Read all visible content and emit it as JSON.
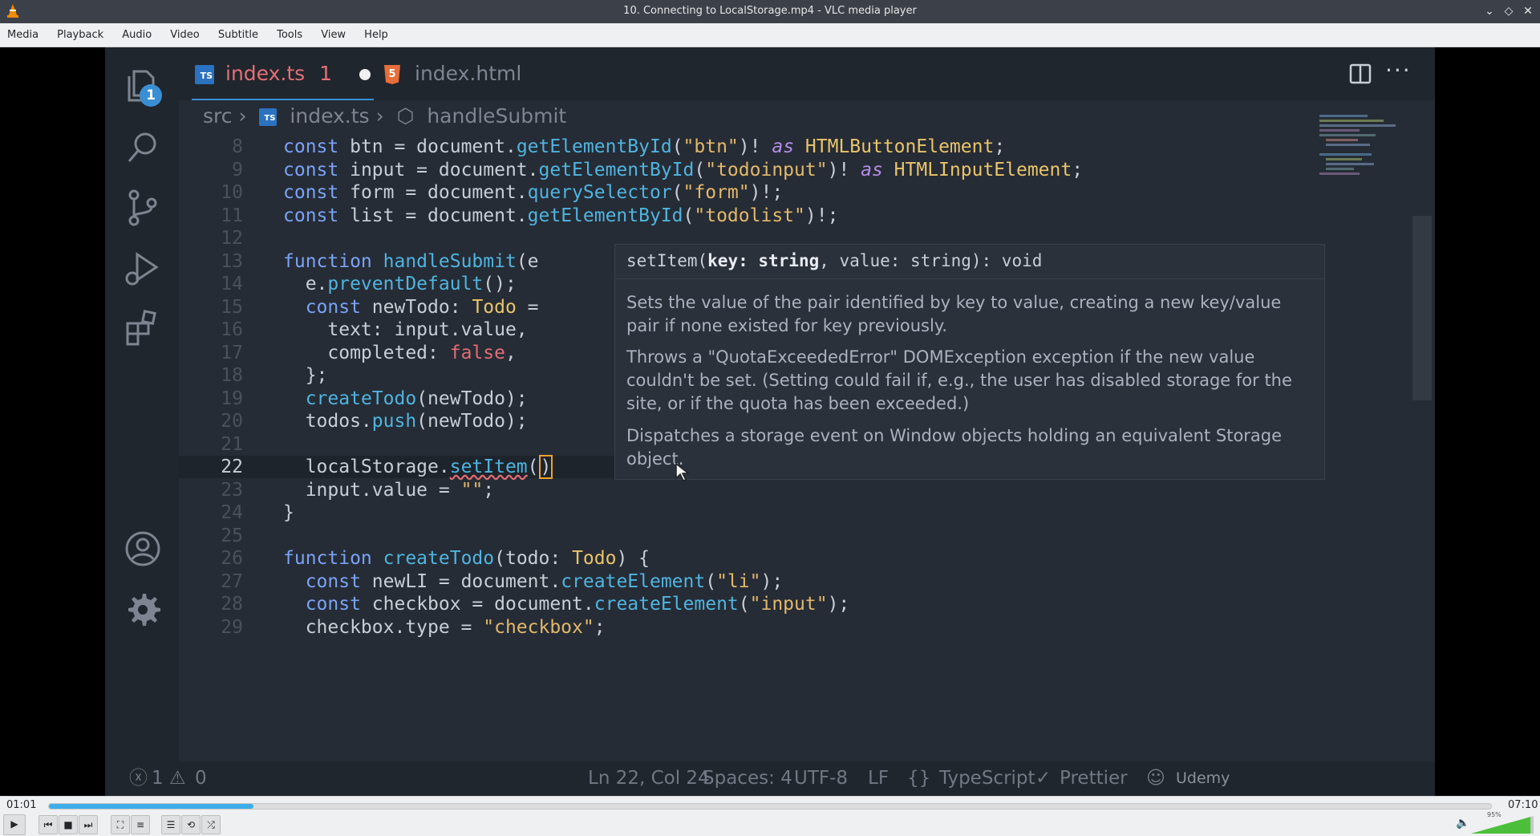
{
  "window": {
    "title": "10. Connecting to LocalStorage.mp4 - VLC media player"
  },
  "menu": [
    "Media",
    "Playback",
    "Audio",
    "Video",
    "Subtitle",
    "Tools",
    "View",
    "Help"
  ],
  "vscode": {
    "explorer_badge": "1",
    "tabs": [
      {
        "label": "index.ts",
        "problems": "1",
        "icon": "typescript-icon",
        "active": true,
        "dirty": true
      },
      {
        "label": "index.html",
        "icon": "html5-icon",
        "active": false
      }
    ],
    "breadcrumb": [
      "src",
      "index.ts",
      "handleSubmit"
    ],
    "current_line": "22",
    "code_lines": [
      {
        "n": "8",
        "text": "const btn = document.getElementById(\"btn\")! as HTMLButtonElement;"
      },
      {
        "n": "9",
        "text": "const input = document.getElementById(\"todoinput\")! as HTMLInputElement;"
      },
      {
        "n": "10",
        "text": "const form = document.querySelector(\"form\")!;"
      },
      {
        "n": "11",
        "text": "const list = document.getElementById(\"todolist\")!;"
      },
      {
        "n": "12",
        "text": ""
      },
      {
        "n": "13",
        "text": "function handleSubmit(e"
      },
      {
        "n": "14",
        "text": "  e.preventDefault();"
      },
      {
        "n": "15",
        "text": "  const newTodo: Todo ="
      },
      {
        "n": "16",
        "text": "    text: input.value,"
      },
      {
        "n": "17",
        "text": "    completed: false,"
      },
      {
        "n": "18",
        "text": "  };"
      },
      {
        "n": "19",
        "text": "  createTodo(newTodo);"
      },
      {
        "n": "20",
        "text": "  todos.push(newTodo);"
      },
      {
        "n": "21",
        "text": ""
      },
      {
        "n": "22",
        "text": "  localStorage.setItem()"
      },
      {
        "n": "23",
        "text": "  input.value = \"\";"
      },
      {
        "n": "24",
        "text": "}"
      },
      {
        "n": "25",
        "text": ""
      },
      {
        "n": "26",
        "text": "function createTodo(todo: Todo) {"
      },
      {
        "n": "27",
        "text": "  const newLI = document.createElement(\"li\");"
      },
      {
        "n": "28",
        "text": "  const checkbox = document.createElement(\"input\");"
      },
      {
        "n": "29",
        "text": "  checkbox.type = \"checkbox\";"
      }
    ],
    "hover": {
      "signature_name": "setItem(",
      "signature_param": "key: string",
      "signature_rest": ", value: string): void",
      "paragraphs": [
        "Sets the value of the pair identified by key to value, creating a new key/value pair if none existed for key previously.",
        "Throws a \"QuotaExceededError\" DOMException exception if the new value couldn't be set. (Setting could fail if, e.g., the user has disabled storage for the site, or if the quota has been exceeded.)",
        "Dispatches a storage event on Window objects holding an equivalent Storage object."
      ]
    },
    "status": {
      "errors": "1",
      "warnings": "0",
      "position": "Ln 22, Col 24",
      "spaces": "Spaces: 4",
      "encoding": "UTF-8",
      "eol": "LF",
      "language": "TypeScript",
      "formatter": "Prettier",
      "watermark": "Udemy"
    }
  },
  "player": {
    "elapsed": "01:01",
    "total": "07:10",
    "progress": 0.142,
    "volume_label": "95%",
    "volume": 0.95
  },
  "colors": {
    "accent": "#3daee9",
    "editor_bg": "#262c35",
    "tab_active_text": "#e36f77"
  }
}
